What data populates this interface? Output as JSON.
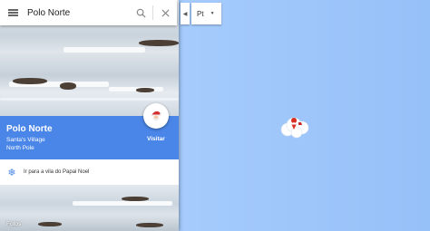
{
  "search": {
    "query": "Polo Norte"
  },
  "place": {
    "title": "Polo Norte",
    "subtitle_line1": "Santa's Village",
    "subtitle_line2": "North Pole",
    "visit_label": "Visitar"
  },
  "directions": {
    "label": "Ir para a vila do Papai Noel"
  },
  "photos": {
    "label": "Fotos"
  },
  "language": {
    "selected": "Pt"
  },
  "colors": {
    "accent": "#4a86e8",
    "map_ocean": "#a5cbfc"
  },
  "icons": {
    "menu": "menu-icon",
    "search": "search-icon",
    "close": "close-icon",
    "collapse": "chevron-left-icon",
    "dropdown": "caret-down-icon",
    "snowflake": "snowflake-icon",
    "santa": "santa-icon",
    "marker": "map-pin-icon"
  }
}
